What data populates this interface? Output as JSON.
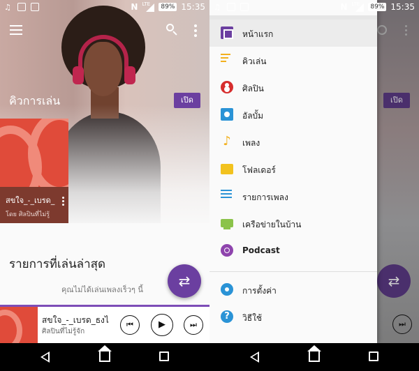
{
  "status_bar": {
    "time": "15:35",
    "battery": "89%",
    "network": "LTE",
    "nfc": "N"
  },
  "left": {
    "section_title": "คิวการเล่น",
    "open_button": "เปิด",
    "card": {
      "title": "สขใจ_-_เบรด_",
      "subtitle": "โดย ศิลปินที่ไม่รู้"
    },
    "recent_title": "รายการที่เล่นล่าสุด",
    "recent_empty": "คุณไม่ได้เล่นเพลงเร็วๆ นี้",
    "mini_player": {
      "title": "สขใจ_-_เบรด_ธงไ",
      "subtitle": "ศิลปินที่ไม่รู้จัก",
      "prev_icon": "⏮",
      "play_icon": "▶",
      "next_icon": "⏭"
    },
    "fab_icon": "⇄"
  },
  "right": {
    "open_button": "เปิด",
    "next_icon": "⏭",
    "fab_icon": "⇄",
    "drawer": {
      "home": "หน้าแรก",
      "queue": "คิวเล่น",
      "artists": "ศิลปิน",
      "albums": "อัลบั้ม",
      "songs": "เพลง",
      "folders": "โฟลเดอร์",
      "playlists": "รายการเพลง",
      "home_network": "เครือข่ายในบ้าน",
      "podcast": "Podcast",
      "settings": "การตั้งค่า",
      "help": "วิธีใช้"
    }
  },
  "icons": {
    "song_glyph": "♪",
    "help_glyph": "?"
  },
  "colors": {
    "accent": "#6b3fa0",
    "player_bar": "#7d4db7"
  }
}
